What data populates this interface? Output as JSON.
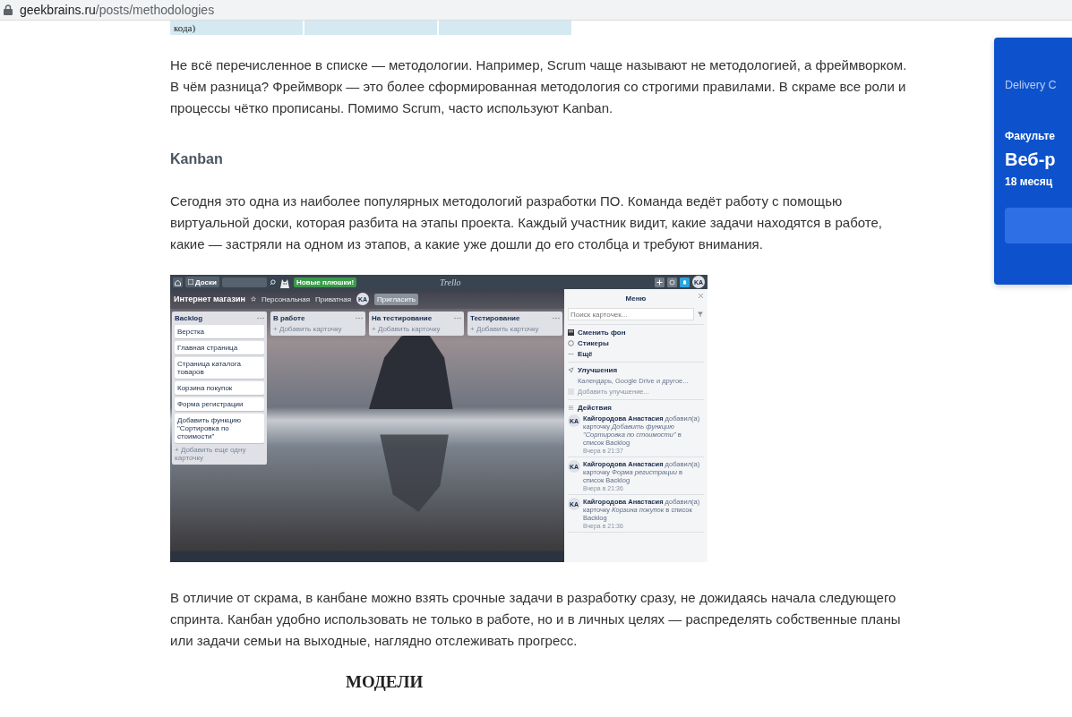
{
  "address_bar": {
    "host": "geekbrains.ru",
    "path": "/posts/methodologies"
  },
  "table_fragment": {
    "cells": [
      "кода)"
    ]
  },
  "paragraphs_top": [
    "Не всё перечисленное в списке — методологии. Например, Scrum чаще называют не методологией, а фреймворком. В чём разница? Фреймворк — это более сформированная методология со строгими правилами. В скраме все роли и процессы чётко прописаны. Помимо Scrum, часто используют Kanban."
  ],
  "heading": "Kanban",
  "paragraph_kanban": "Сегодня это одна из наиболее популярных методологий разработки ПО. Команда ведёт работу с помощью виртуальной доски, которая разбита на этапы проекта. Каждый участник видит, какие задачи находятся в работе, какие — застряли на одном из этапов, а какие уже дошли до его столбца и требуют внимания.",
  "trello": {
    "topbar": {
      "boards": "Доски",
      "badge": "Новые плюшки!",
      "logo": "Trello",
      "avatar": "KA"
    },
    "board": {
      "title": "Интернет магазин",
      "team": "Персональная",
      "visibility": "Приватная",
      "avatar": "KA",
      "invite": "Пригласить"
    },
    "lists": [
      {
        "title": "Backlog",
        "cards": [
          "Верстка",
          "Главная страница",
          "Страница каталога товаров",
          "Корзина покупок",
          "Форма регистрации",
          "Добавить функцию \"Сортировка по стоимости\""
        ],
        "add": "+ Добавить еще одну карточку"
      },
      {
        "title": "В работе",
        "add": "+ Добавить карточку"
      },
      {
        "title": "На тестирование",
        "add": "+ Добавить карточку"
      },
      {
        "title": "Тестирование",
        "add": "+ Добавить карточку"
      }
    ],
    "menu": {
      "title": "Меню",
      "search_placeholder": "Поиск карточек...",
      "items": [
        {
          "kind": "background",
          "label": "Сменить фон"
        },
        {
          "kind": "stickers",
          "label": "Стикеры"
        },
        {
          "kind": "more",
          "label": "Ещё"
        }
      ],
      "powerups": {
        "title": "Улучшения",
        "subtitle": "Календарь, Google Drive и другое...",
        "add": "Добавить улучшение..."
      },
      "activity_title": "Действия",
      "activities": [
        {
          "avatar": "KA",
          "text": "**Кайгородова Анастасия** добавил(а) карточку *Добавить функцию \"Сортировка по стоимости\"* в список Backlog",
          "time": "Вчера в 21:37"
        },
        {
          "avatar": "KA",
          "text": "**Кайгородова Анастасия** добавил(а) карточку *Форма регистрации* в список Backlog",
          "time": "Вчера в 21:36"
        },
        {
          "avatar": "KA",
          "text": "**Кайгородова Анастасия** добавил(а) карточку *Корзина покупок* в список Backlog",
          "time": "Вчера в 21:36"
        }
      ]
    }
  },
  "paragraph_after": "В отличие от скрама, в канбане можно взять срочные задачи в разработку сразу, не дожидаясь начала следующего спринта. Канбан удобно использовать не только в работе, но и в личных целях — распределять собственные планы или задачи семьи на выходные, наглядно отслеживать прогресс.",
  "figure_title": "МОДЕЛИ",
  "promo_card": {
    "label": "Delivery C",
    "faculty": "Факульте",
    "title": "Веб-р",
    "duration": "18 месяц"
  }
}
